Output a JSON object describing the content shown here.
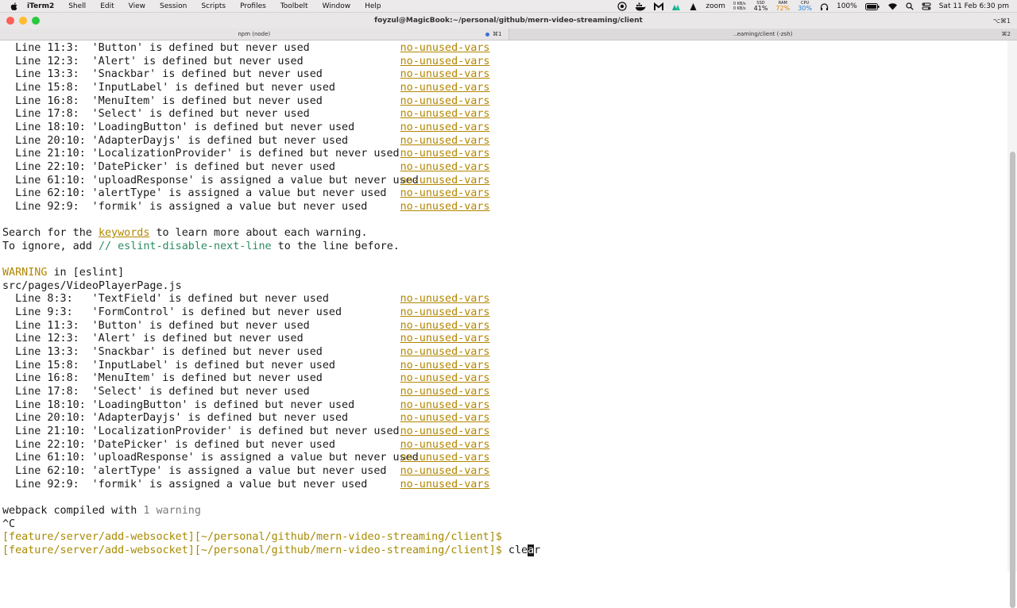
{
  "menubar": {
    "app_name": "iTerm2",
    "items": [
      "Shell",
      "Edit",
      "View",
      "Session",
      "Scripts",
      "Profiles",
      "Toolbelt",
      "Window",
      "Help"
    ],
    "zoom_label": "zoom",
    "net_up": "0 KB/s",
    "net_down": "0 KB/s",
    "ssd_label": "SSD",
    "ssd_value": "41%",
    "ram_label": "RAM",
    "ram_value": "72%",
    "cpu_label": "CPU",
    "cpu_value": "30%",
    "battery": "100%",
    "datetime": "Sat 11 Feb  6:30 pm"
  },
  "window": {
    "title": "foyzul@MagicBook:~/personal/github/mern-video-streaming/client",
    "shortcut": "⌥⌘1"
  },
  "tabs": [
    {
      "label": "npm (node)",
      "shortcut": "⌘1"
    },
    {
      "label": "..eaming/client (-zsh)",
      "shortcut": "⌘2"
    }
  ],
  "terminal": {
    "block1": [
      {
        "loc": "Line 11:3:",
        "msg": "'Button' is defined but never used",
        "rule": "no-unused-vars"
      },
      {
        "loc": "Line 12:3:",
        "msg": "'Alert' is defined but never used",
        "rule": "no-unused-vars"
      },
      {
        "loc": "Line 13:3:",
        "msg": "'Snackbar' is defined but never used",
        "rule": "no-unused-vars"
      },
      {
        "loc": "Line 15:8:",
        "msg": "'InputLabel' is defined but never used",
        "rule": "no-unused-vars"
      },
      {
        "loc": "Line 16:8:",
        "msg": "'MenuItem' is defined but never used",
        "rule": "no-unused-vars"
      },
      {
        "loc": "Line 17:8:",
        "msg": "'Select' is defined but never used",
        "rule": "no-unused-vars"
      },
      {
        "loc": "Line 18:10:",
        "msg": "'LoadingButton' is defined but never used",
        "rule": "no-unused-vars"
      },
      {
        "loc": "Line 20:10:",
        "msg": "'AdapterDayjs' is defined but never used",
        "rule": "no-unused-vars"
      },
      {
        "loc": "Line 21:10:",
        "msg": "'LocalizationProvider' is defined but never used",
        "rule": "no-unused-vars"
      },
      {
        "loc": "Line 22:10:",
        "msg": "'DatePicker' is defined but never used",
        "rule": "no-unused-vars"
      },
      {
        "loc": "Line 61:10:",
        "msg": "'uploadResponse' is assigned a value but never used",
        "rule": "no-unused-vars"
      },
      {
        "loc": "Line 62:10:",
        "msg": "'alertType' is assigned a value but never used",
        "rule": "no-unused-vars"
      },
      {
        "loc": "Line 92:9:",
        "msg": "'formik' is assigned a value but never used",
        "rule": "no-unused-vars"
      }
    ],
    "search_prefix": "Search for the ",
    "search_keyword": "keywords",
    "search_suffix": " to learn more about each warning.",
    "ignore_prefix": "To ignore, add ",
    "ignore_comment": "// eslint-disable-next-line",
    "ignore_suffix": " to the line before.",
    "warning_word": "WARNING",
    "warning_rest": " in [eslint]",
    "file_path": "src/pages/VideoPlayerPage.js",
    "block2": [
      {
        "loc": "Line 8:3:",
        "msg": "'TextField' is defined but never used",
        "rule": "no-unused-vars"
      },
      {
        "loc": "Line 9:3:",
        "msg": "'FormControl' is defined but never used",
        "rule": "no-unused-vars"
      },
      {
        "loc": "Line 11:3:",
        "msg": "'Button' is defined but never used",
        "rule": "no-unused-vars"
      },
      {
        "loc": "Line 12:3:",
        "msg": "'Alert' is defined but never used",
        "rule": "no-unused-vars"
      },
      {
        "loc": "Line 13:3:",
        "msg": "'Snackbar' is defined but never used",
        "rule": "no-unused-vars"
      },
      {
        "loc": "Line 15:8:",
        "msg": "'InputLabel' is defined but never used",
        "rule": "no-unused-vars"
      },
      {
        "loc": "Line 16:8:",
        "msg": "'MenuItem' is defined but never used",
        "rule": "no-unused-vars"
      },
      {
        "loc": "Line 17:8:",
        "msg": "'Select' is defined but never used",
        "rule": "no-unused-vars"
      },
      {
        "loc": "Line 18:10:",
        "msg": "'LoadingButton' is defined but never used",
        "rule": "no-unused-vars"
      },
      {
        "loc": "Line 20:10:",
        "msg": "'AdapterDayjs' is defined but never used",
        "rule": "no-unused-vars"
      },
      {
        "loc": "Line 21:10:",
        "msg": "'LocalizationProvider' is defined but never used",
        "rule": "no-unused-vars"
      },
      {
        "loc": "Line 22:10:",
        "msg": "'DatePicker' is defined but never used",
        "rule": "no-unused-vars"
      },
      {
        "loc": "Line 61:10:",
        "msg": "'uploadResponse' is assigned a value but never used",
        "rule": "no-unused-vars"
      },
      {
        "loc": "Line 62:10:",
        "msg": "'alertType' is assigned a value but never used",
        "rule": "no-unused-vars"
      },
      {
        "loc": "Line 92:9:",
        "msg": "'formik' is assigned a value but never used",
        "rule": "no-unused-vars"
      }
    ],
    "compiled_prefix": "webpack compiled with ",
    "compiled_count": "1 warning",
    "interrupt": "^C",
    "prompt": "[feature/server/add-websocket][~/personal/github/mern-video-streaming/client]$",
    "command_before_cursor": "cle",
    "command_cursor_char": "a",
    "command_after_cursor": "r"
  },
  "colors": {
    "rule": "#b28600",
    "comment": "#2c8c62",
    "prompt": "#a88a00"
  }
}
